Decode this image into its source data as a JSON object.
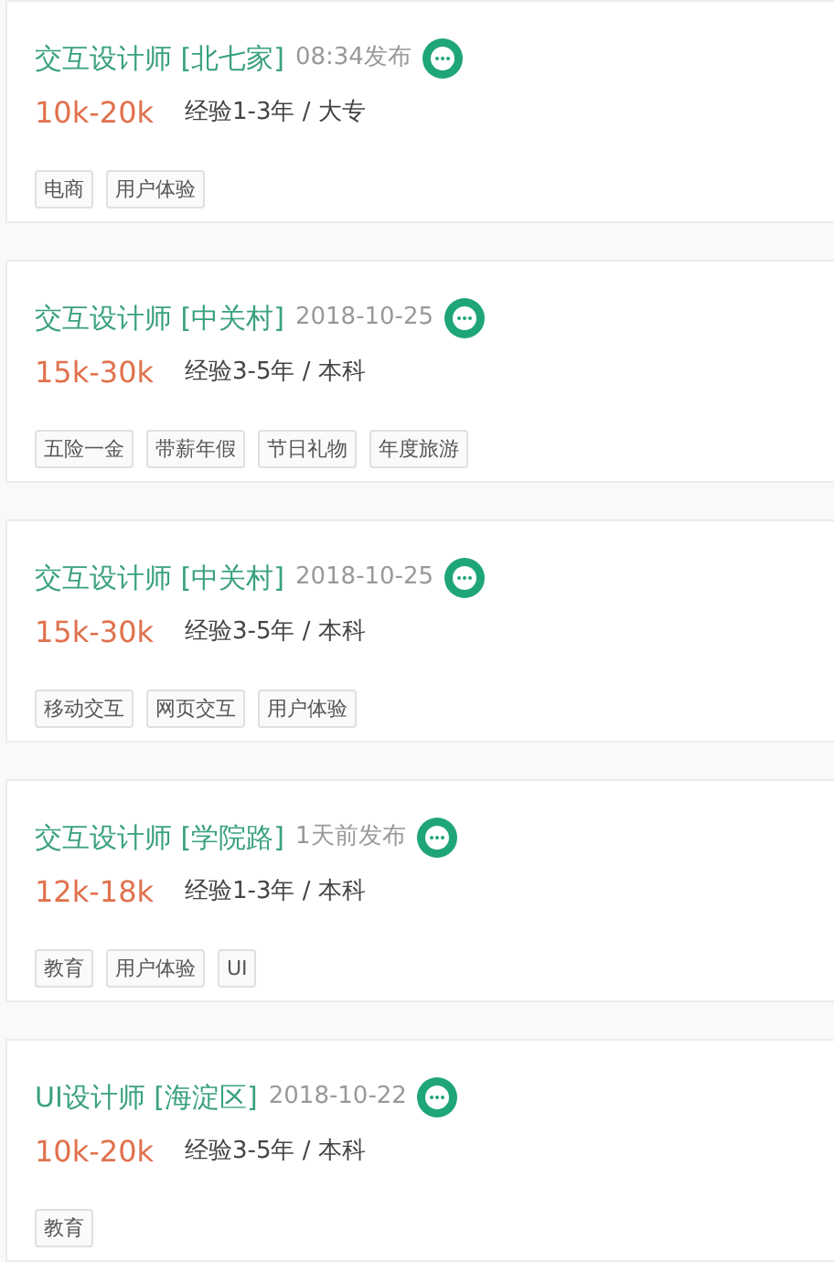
{
  "jobs": [
    {
      "title": "交互设计师 [北七家]",
      "posted": "08:34发布",
      "salary": "10k-20k",
      "requirements": "经验1-3年 / 大专",
      "tags": [
        "电商",
        "用户体验"
      ]
    },
    {
      "title": "交互设计师 [中关村]",
      "posted": "2018-10-25",
      "salary": "15k-30k",
      "requirements": "经验3-5年 / 本科",
      "tags": [
        "五险一金",
        "带薪年假",
        "节日礼物",
        "年度旅游"
      ]
    },
    {
      "title": "交互设计师 [中关村]",
      "posted": "2018-10-25",
      "salary": "15k-30k",
      "requirements": "经验3-5年 / 本科",
      "tags": [
        "移动交互",
        "网页交互",
        "用户体验"
      ]
    },
    {
      "title": "交互设计师 [学院路]",
      "posted": "1天前发布",
      "salary": "12k-18k",
      "requirements": "经验1-3年 / 本科",
      "tags": [
        "教育",
        "用户体验",
        "UI"
      ]
    },
    {
      "title": "UI设计师 [海淀区]",
      "posted": "2018-10-22",
      "salary": "10k-20k",
      "requirements": "经验3-5年 / 本科",
      "tags": [
        "教育"
      ]
    }
  ]
}
